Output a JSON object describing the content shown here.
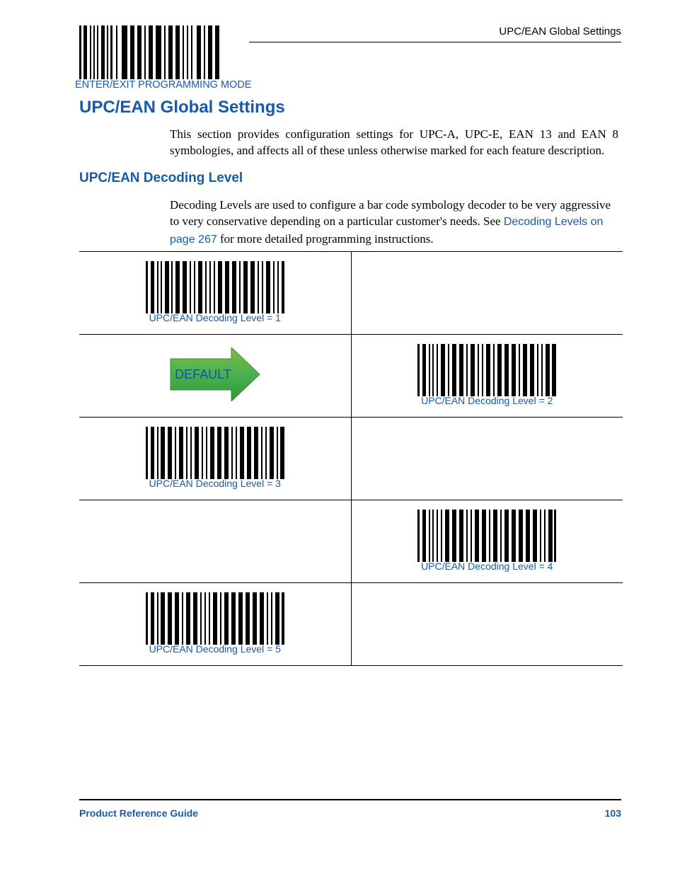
{
  "running_head": "UPC/EAN Global Settings",
  "programming_barcode_label": "ENTER/EXIT PROGRAMMING MODE",
  "h1": "UPC/EAN Global Settings",
  "intro": "This section provides configuration settings for UPC-A, UPC-E, EAN 13 and EAN 8 symbologies, and affects all of these unless otherwise marked for each feature description.",
  "h2": "UPC/EAN Decoding Level",
  "para2_pre": "Decoding Levels are used to configure a bar code symbology decoder to be very aggressive to very conservative depending on a particular customer's needs. See ",
  "para2_link": "Decoding Levels on page 267",
  "para2_post": " for more detailed programming instructions.",
  "default_label": "DEFAULT",
  "cells": {
    "r1c1": "UPC/EAN Decoding Level = 1",
    "r2c2": "UPC/EAN Decoding Level = 2",
    "r3c1": "UPC/EAN Decoding Level = 3",
    "r4c2": "UPC/EAN Decoding Level = 4",
    "r5c1": "UPC/EAN Decoding Level = 5"
  },
  "footer_left": "Product Reference Guide",
  "footer_right": "103"
}
